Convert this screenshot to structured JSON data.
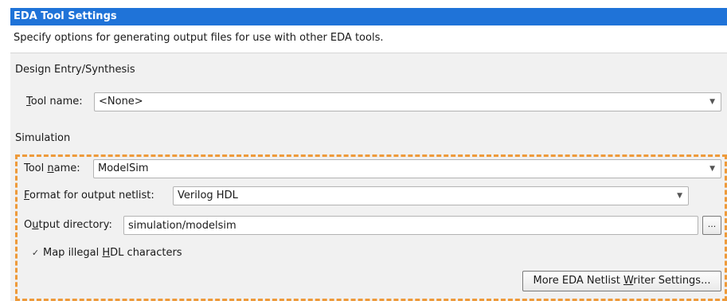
{
  "header": {
    "title": "EDA Tool Settings"
  },
  "description": "Specify options for generating output files for use with other EDA tools.",
  "design_entry": {
    "section_title": "Design Entry/Synthesis",
    "tool_label_first": "T",
    "tool_label_rest": "ool name:",
    "tool_value": "<None>"
  },
  "simulation": {
    "section_title": "Simulation",
    "tool_label_pre": "Tool ",
    "tool_label_u": "n",
    "tool_label_post": "ame:",
    "tool_value": "ModelSim",
    "format_label_u": "F",
    "format_label_rest": "ormat for output netlist:",
    "format_value": "Verilog HDL",
    "outdir_label_pre": "O",
    "outdir_label_u": "u",
    "outdir_label_post": "tput directory:",
    "outdir_value": "simulation/modelsim",
    "browse_label": "...",
    "map_checked": true,
    "map_label_pre": "Map illegal ",
    "map_label_u": "H",
    "map_label_post": "DL characters",
    "more_pre": "More EDA Netlist ",
    "more_u": "W",
    "more_post": "riter Settings..."
  },
  "colors": {
    "header_bg": "#1f73d8",
    "highlight_dash": "#ee9a3a"
  },
  "icons": {
    "dropdown": "chevron-down-icon",
    "checkbox": "check-icon"
  }
}
